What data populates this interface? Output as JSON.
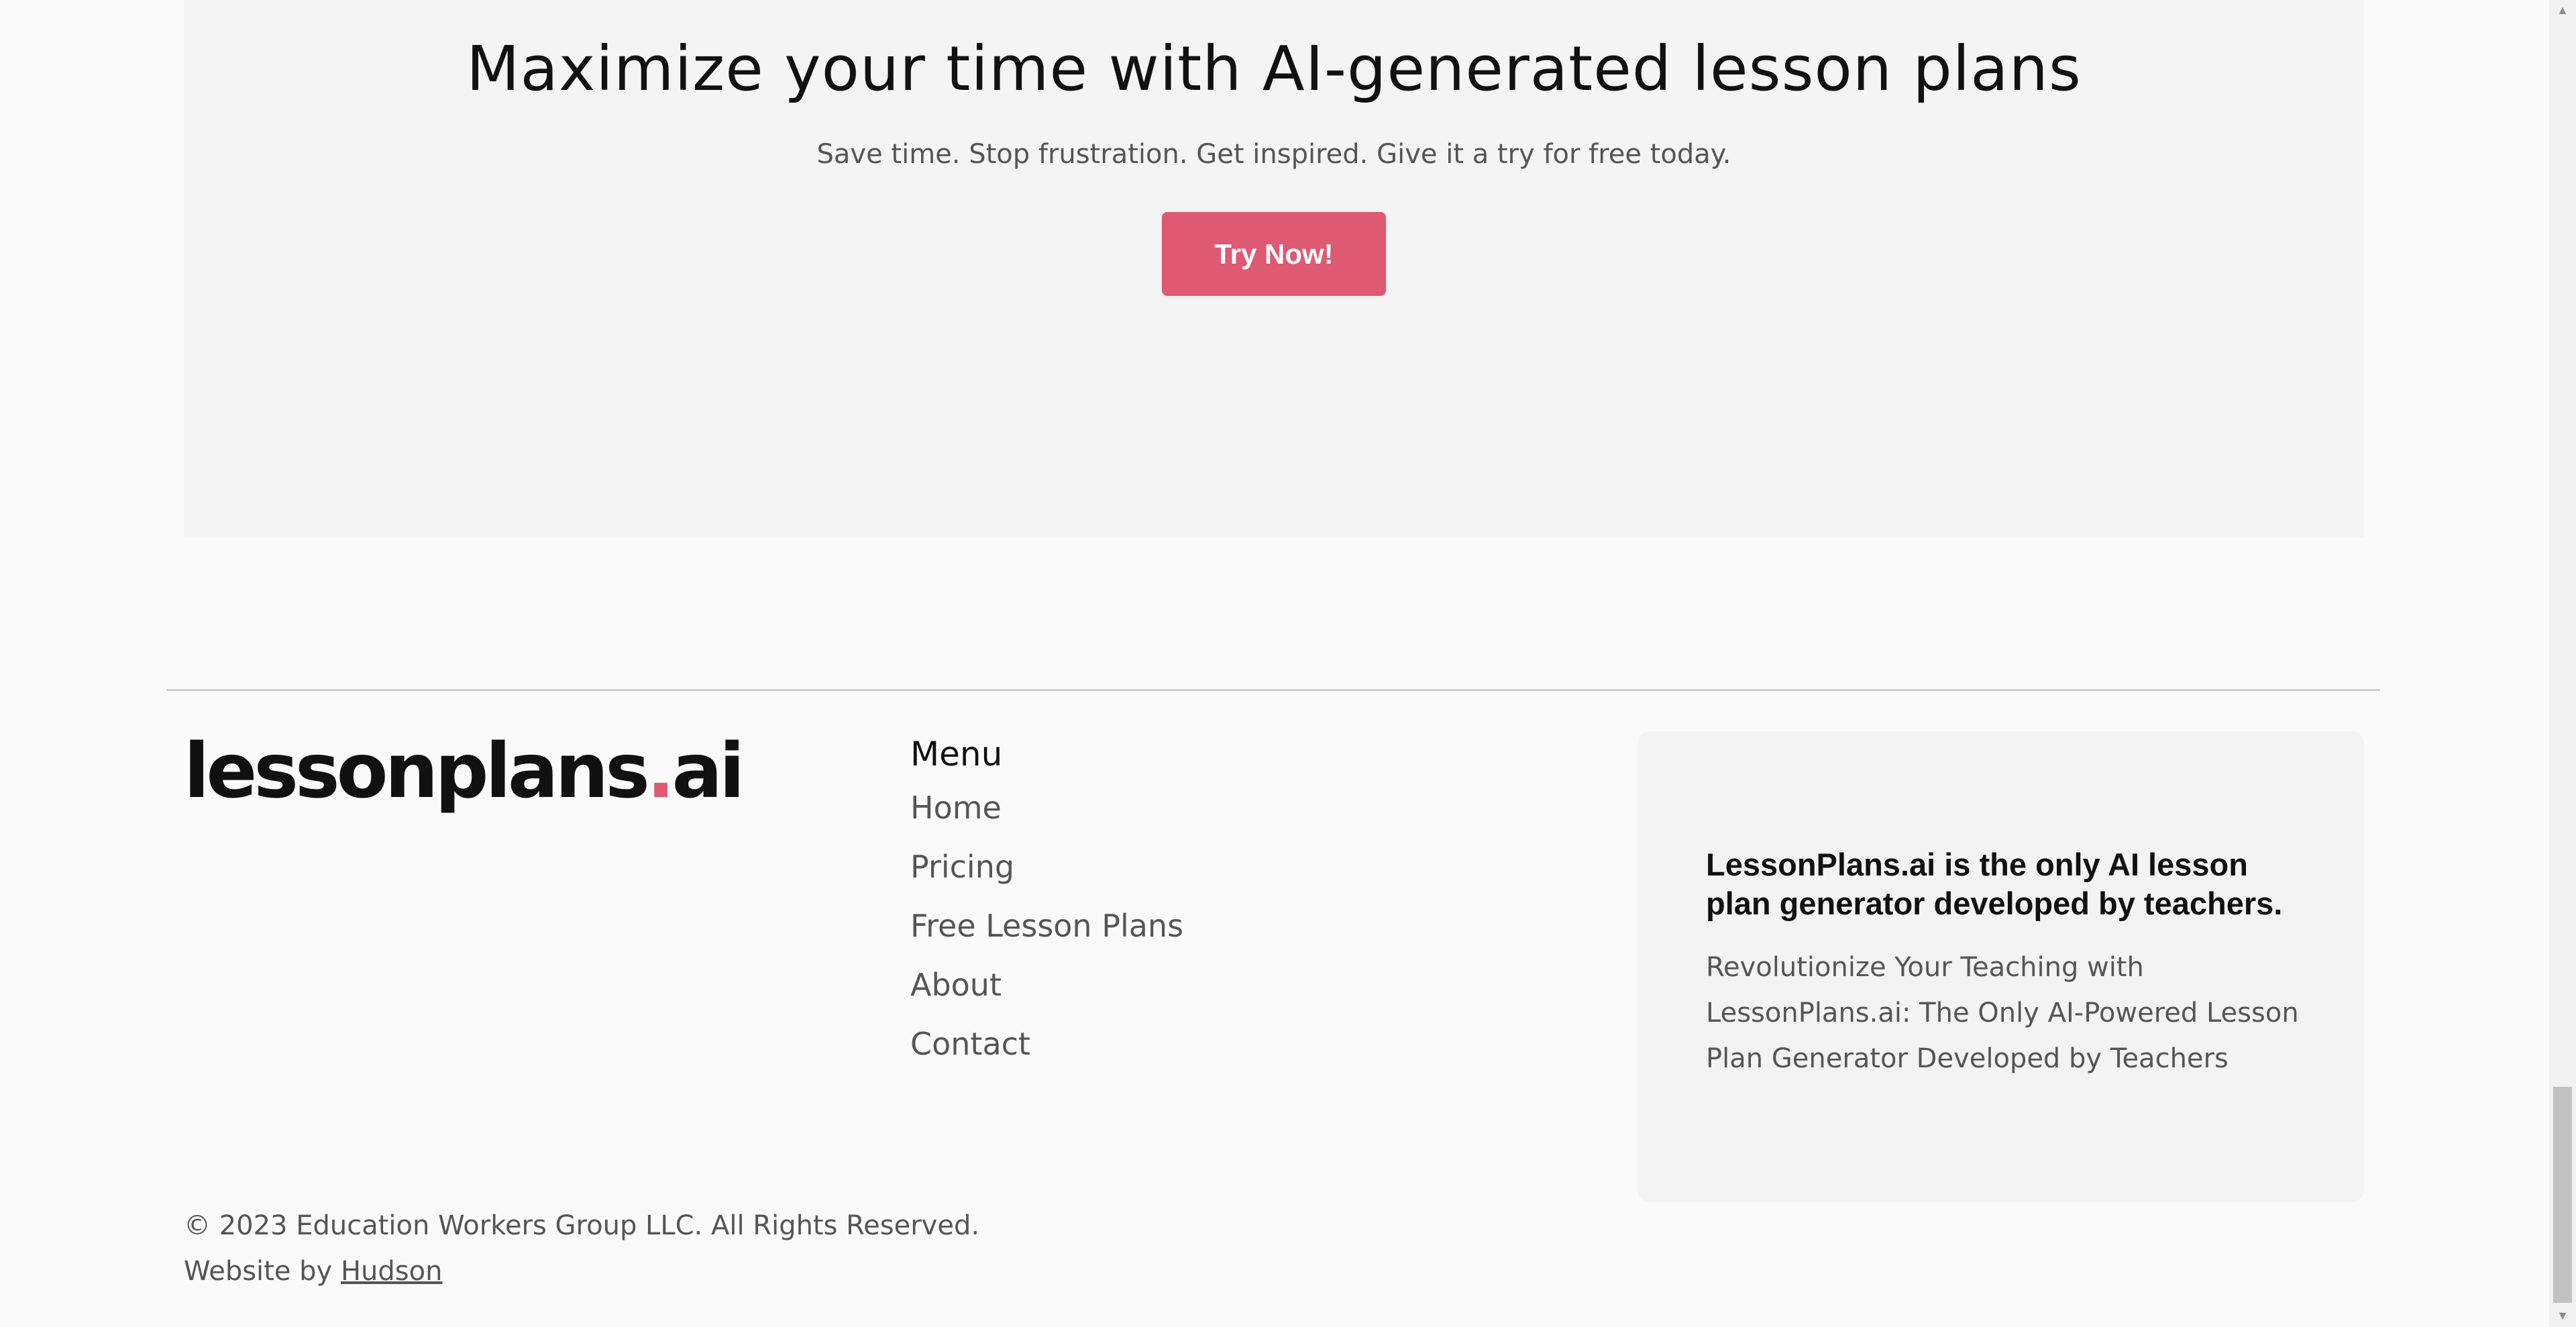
{
  "cta": {
    "title": "Maximize your time with AI-generated lesson plans",
    "subtitle": "Save time. Stop frustration. Get inspired. Give it a try for free today.",
    "button_label": "Try Now!"
  },
  "footer": {
    "logo": {
      "text": "lessonplans",
      "dot": ".",
      "suffix": "ai"
    },
    "menu": {
      "heading": "Menu",
      "items": [
        {
          "label": "Home"
        },
        {
          "label": "Pricing"
        },
        {
          "label": "Free Lesson Plans"
        },
        {
          "label": "About"
        },
        {
          "label": "Contact"
        }
      ]
    },
    "about": {
      "title": "LessonPlans.ai is the only AI lesson plan generator developed by teachers.",
      "text": "Revolutionize Your Teaching with LessonPlans.ai: The Only AI-Powered Lesson Plan Generator Developed by Teachers"
    },
    "copyright": "© 2023 Education Workers Group LLC. All Rights Reserved.",
    "credit_prefix": "Website by",
    "credit_link": "Hudson"
  },
  "colors": {
    "accent": "#dd5a72",
    "page_background": "#fafafa",
    "section_background": "#f4f4f4",
    "heading_text": "#111111",
    "body_text": "#555555"
  },
  "scrollbar": {
    "position_fraction": 1.0,
    "up_icon": "scroll-up-arrow-icon",
    "down_icon": "scroll-down-arrow-icon"
  }
}
